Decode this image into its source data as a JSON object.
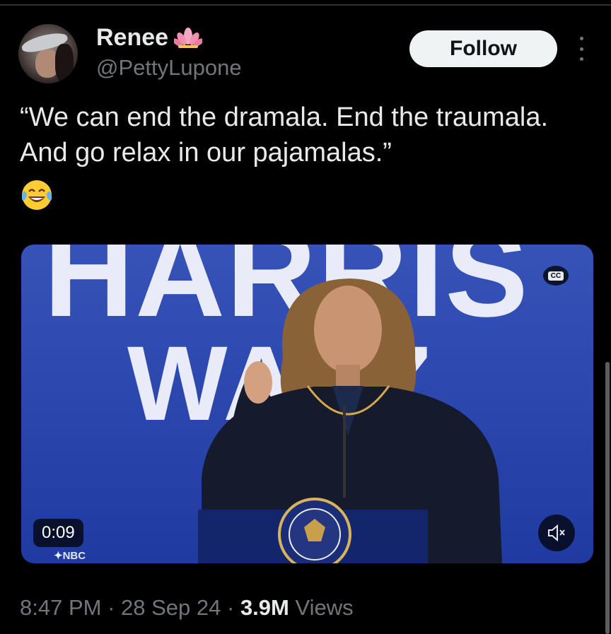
{
  "user": {
    "name": "Renee",
    "handle": "@PettyLupone",
    "badge_icon": "lotus-icon"
  },
  "actions": {
    "follow_label": "Follow",
    "more_icon": "more-vertical-icon"
  },
  "tweet": {
    "text": "“We can end the dramala. End the traumala. And go relax in our pajamalas.”",
    "emoji_icon": "face-with-tears-of-joy-icon"
  },
  "video": {
    "scene_text_line1": "HARRIS",
    "scene_text_line2": "WALZ",
    "cc_label": "CC",
    "duration": "0:09",
    "watermark": "NBC",
    "mute_icon": "speaker-muted-icon",
    "accent": "#2a46ad"
  },
  "meta": {
    "time": "8:47 PM",
    "sep1": " · ",
    "date": "28 Sep 24",
    "sep2": " · ",
    "views_count": "3.9M",
    "views_label": " Views"
  },
  "colors": {
    "background": "#000000",
    "text_primary": "#e7e9ea",
    "text_secondary": "#71767b",
    "follow_bg": "#eff3f4"
  }
}
